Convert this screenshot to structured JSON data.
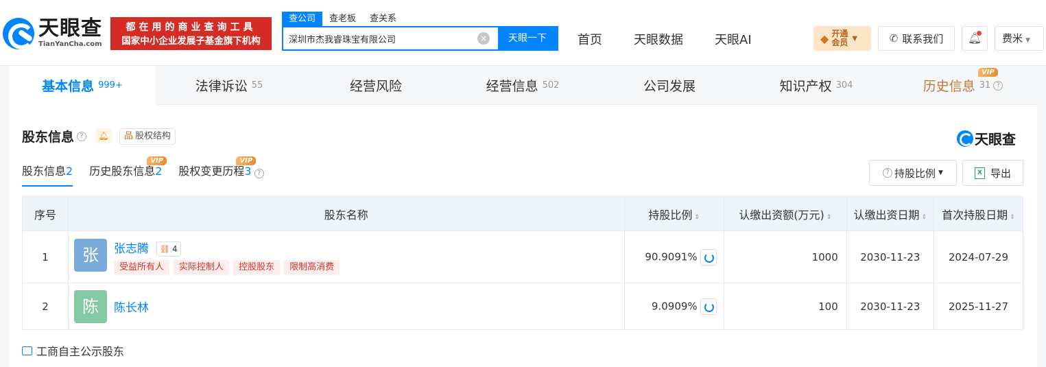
{
  "header": {
    "logo_cn": "天眼查",
    "logo_en": "TianYanCha.com",
    "slogan_line1": "都在用的商业查询工具",
    "slogan_line2": "国家中小企业发展子基金旗下机构",
    "search_tabs": [
      "查公司",
      "查老板",
      "查关系"
    ],
    "search_value": "深圳市杰我睿珠宝有限公司",
    "search_button": "天眼一下",
    "nav": [
      "首页",
      "天眼数据",
      "天眼AI"
    ],
    "vip_line1": "开通",
    "vip_line2": "会员",
    "contact": "联系我们",
    "user": "费米"
  },
  "main_tabs": [
    {
      "label": "基本信息",
      "count": "999+"
    },
    {
      "label": "法律诉讼",
      "count": "55"
    },
    {
      "label": "经营风险",
      "count": ""
    },
    {
      "label": "经营信息",
      "count": "502"
    },
    {
      "label": "公司发展",
      "count": ""
    },
    {
      "label": "知识产权",
      "count": "304"
    },
    {
      "label": "历史信息",
      "count": "31"
    }
  ],
  "vip_label": "VIP",
  "section": {
    "title": "股东信息",
    "equity_button": "股权结构",
    "brand": "天眼查",
    "sub_tabs": [
      {
        "label": "股东信息",
        "count": "2"
      },
      {
        "label": "历史股东信息",
        "count": "2"
      },
      {
        "label": "股权变更历程",
        "count": "3"
      }
    ],
    "ratio_button": "持股比例",
    "export_button": "导出"
  },
  "table": {
    "headers": [
      "序号",
      "股东名称",
      "持股比例",
      "认缴出资额(万元)",
      "认缴出资日期",
      "首次持股日期"
    ],
    "rows": [
      {
        "idx": "1",
        "avatar": "张",
        "avatar_color": "#7aaad8",
        "name": "张志腾",
        "relation_count": "4",
        "tags": [
          "受益所有人",
          "实际控制人",
          "控股股东",
          "限制高消费"
        ],
        "ratio": "90.9091%",
        "amount": "1000",
        "subscribe_date": "2030-11-23",
        "first_date": "2024-07-29"
      },
      {
        "idx": "2",
        "avatar": "陈",
        "avatar_color": "#84c9a4",
        "name": "陈长林",
        "relation_count": "",
        "tags": [],
        "ratio": "9.0909%",
        "amount": "100",
        "subscribe_date": "2030-11-23",
        "first_date": "2025-11-27"
      }
    ]
  },
  "footer_link": "工商自主公示股东",
  "colors": {
    "brand_blue": "#0084ff",
    "slogan_red": "#d52b25",
    "tag_red": "#d1352b"
  }
}
